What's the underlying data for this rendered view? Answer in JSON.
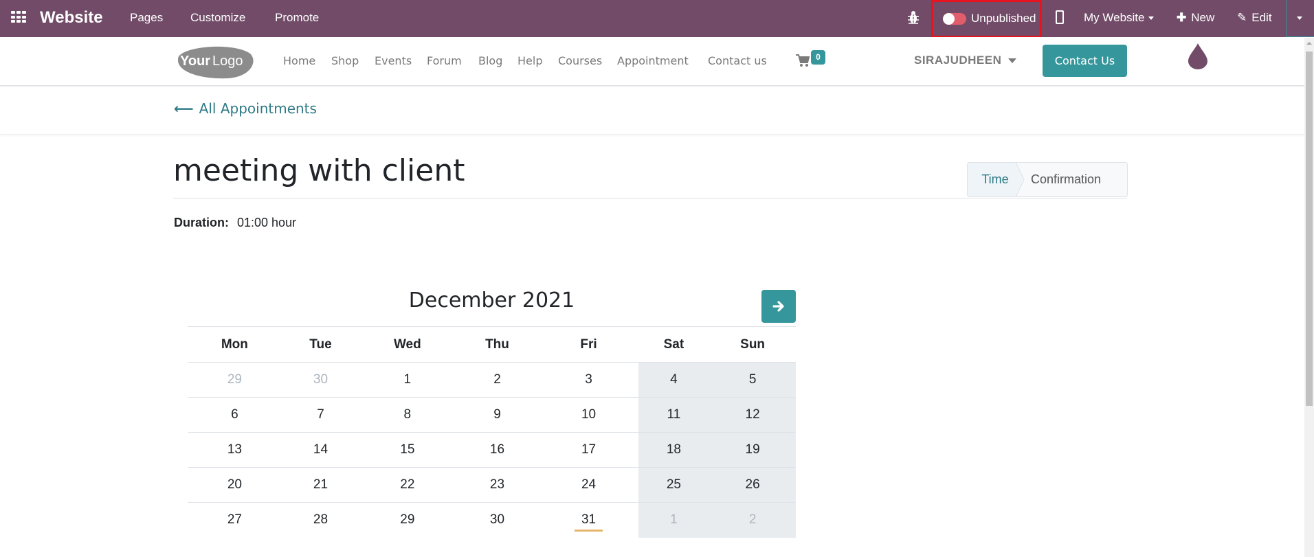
{
  "topbar": {
    "app_name": "Website",
    "menus": [
      "Pages",
      "Customize",
      "Promote"
    ],
    "publish_toggle": {
      "state": "off",
      "label": "Unpublished"
    },
    "website_selector": "My Website",
    "new_label": "New",
    "edit_label": "Edit"
  },
  "navbar": {
    "logo_text": {
      "bold": "Your",
      "light": "Logo"
    },
    "links": [
      "Home",
      "Shop",
      "Events",
      "Forum",
      "Blog",
      "Help",
      "Courses",
      "Appointment",
      "Contact us"
    ],
    "cart_count": "0",
    "user_name": "SIRAJUDHEEN",
    "cta_label": "Contact Us"
  },
  "breadcrumb": {
    "back_label": "All Appointments"
  },
  "appointment": {
    "title": "meeting with client",
    "duration_label": "Duration:",
    "duration_value": "01:00 hour",
    "steps": [
      {
        "label": "Time",
        "active": true
      },
      {
        "label": "Confirmation",
        "active": false
      }
    ]
  },
  "calendar": {
    "month_title": "December 2021",
    "weekdays": [
      "Mon",
      "Tue",
      "Wed",
      "Thu",
      "Fri",
      "Sat",
      "Sun"
    ],
    "weeks": [
      [
        {
          "d": "29",
          "other": true
        },
        {
          "d": "30",
          "other": true
        },
        {
          "d": "1"
        },
        {
          "d": "2"
        },
        {
          "d": "3"
        },
        {
          "d": "4"
        },
        {
          "d": "5"
        }
      ],
      [
        {
          "d": "6"
        },
        {
          "d": "7"
        },
        {
          "d": "8"
        },
        {
          "d": "9"
        },
        {
          "d": "10"
        },
        {
          "d": "11"
        },
        {
          "d": "12"
        }
      ],
      [
        {
          "d": "13"
        },
        {
          "d": "14"
        },
        {
          "d": "15"
        },
        {
          "d": "16"
        },
        {
          "d": "17"
        },
        {
          "d": "18"
        },
        {
          "d": "19"
        }
      ],
      [
        {
          "d": "20"
        },
        {
          "d": "21"
        },
        {
          "d": "22"
        },
        {
          "d": "23"
        },
        {
          "d": "24"
        },
        {
          "d": "25"
        },
        {
          "d": "26"
        }
      ],
      [
        {
          "d": "27"
        },
        {
          "d": "28"
        },
        {
          "d": "29"
        },
        {
          "d": "30"
        },
        {
          "d": "31",
          "today": true
        },
        {
          "d": "1",
          "other": true
        },
        {
          "d": "2",
          "other": true
        }
      ]
    ]
  },
  "colors": {
    "topbar": "#714b67",
    "accent": "#35979c",
    "highlight": "#e5141e",
    "today_underline": "#e7b46c"
  }
}
